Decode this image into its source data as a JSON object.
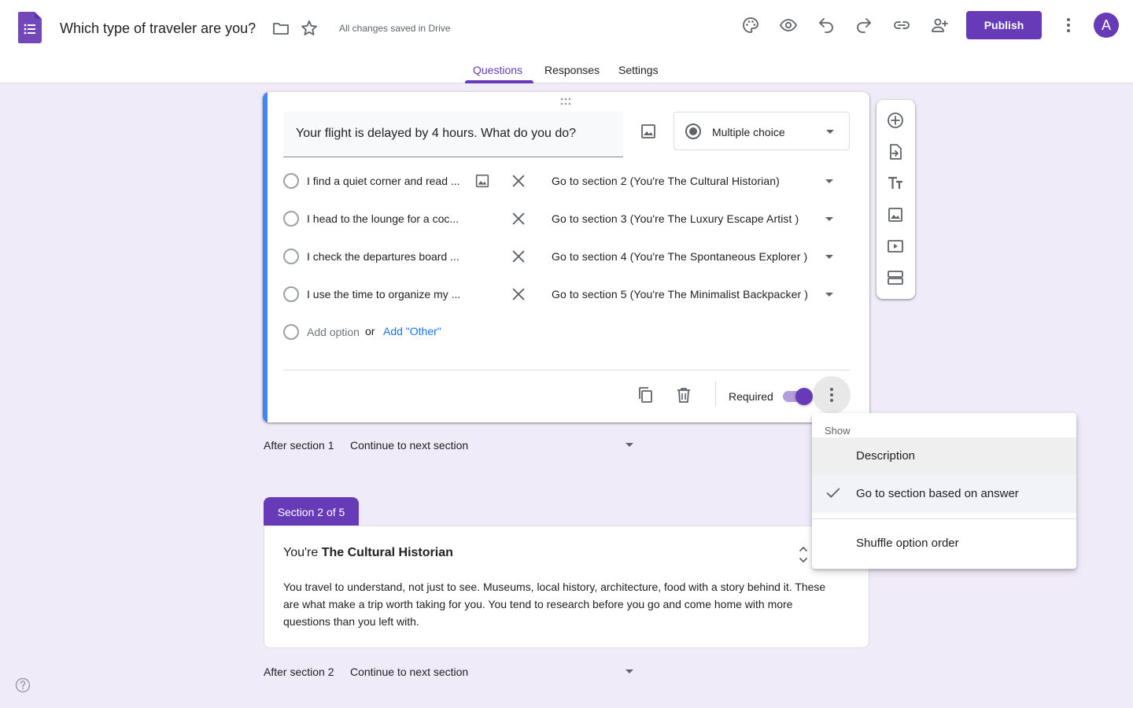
{
  "header": {
    "title": "Which type of traveler are you?",
    "save_status": "All changes saved in Drive",
    "publish_label": "Publish",
    "avatar_initial": "A"
  },
  "tabs": [
    {
      "label": "Questions",
      "active": true
    },
    {
      "label": "Responses",
      "active": false
    },
    {
      "label": "Settings",
      "active": false
    }
  ],
  "question": {
    "title": "Your flight is delayed by 4 hours. What do you do?",
    "type": "Multiple choice",
    "options": [
      {
        "text": "I find a quiet corner and read ...",
        "goto": "Go to section 2 (You're The Cultural Historian)"
      },
      {
        "text": "I head to the lounge for a coc...",
        "goto": "Go to section 3 (You're The Luxury Escape Artist )"
      },
      {
        "text": "I check the departures board ...",
        "goto": "Go to section 4 (You're The Spontaneous Explorer )"
      },
      {
        "text": "I use the time to organize my ...",
        "goto": "Go to section 5 (You're The Minimalist Backpacker )"
      }
    ],
    "add_option": "Add option",
    "or": "or",
    "add_other": "Add \"Other\"",
    "required_label": "Required",
    "required": true
  },
  "after_section_1": {
    "label": "After section 1",
    "value": "Continue to next section"
  },
  "section2": {
    "tab_label": "Section 2 of 5",
    "title_prefix": "You're ",
    "title_bold": "The Cultural Historian",
    "description": "You travel to understand, not just to see. Museums, local history, architecture, food with a story behind it. These are what make a trip worth taking for you. You tend to research before you go and come home with more questions than you left with."
  },
  "after_section_2": {
    "label": "After section 2",
    "value": "Continue to next section"
  },
  "menu": {
    "heading": "Show",
    "items": [
      {
        "label": "Description",
        "checked": false
      },
      {
        "label": "Go to section based on answer",
        "checked": true
      },
      {
        "label": "Shuffle option order",
        "checked": false
      }
    ]
  },
  "colors": {
    "accent": "#673ab7",
    "focus_bar": "#4285f4",
    "link": "#1a73e8",
    "background": "#f0ebf8"
  }
}
